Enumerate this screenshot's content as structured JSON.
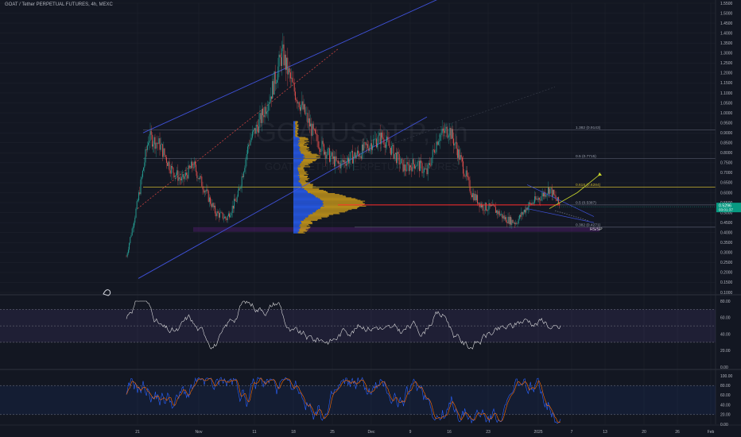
{
  "header": {
    "title": "GOAT / Tether PERPETUAL FUTURES, 4h, MEXC"
  },
  "watermark": {
    "symbol": "GOATUSDT.P, 4h",
    "name": "GOAT / TETHER PERPETUAL FUTURES"
  },
  "colors": {
    "background": "#131722",
    "grid": "#1e222d",
    "candle_up": "#26a69a",
    "candle_down": "#ef5350",
    "channel": "#3f51d8",
    "channel_mid": "#c8413f",
    "fib_line": "#55596a",
    "fib_gold": "#c9b32f",
    "volume_profile_blue": "#2962ff",
    "volume_profile_orange": "#d6a21a",
    "support_zone": "#7b1fa2",
    "resistance_line": "#ff2b2b",
    "rsi_line": "#e8e8e8",
    "rsi_band": "#7e57c2",
    "stoch_k": "#2962ff",
    "stoch_d": "#ff6d00",
    "price_tag": "#089981",
    "arrow": "#c8d62b"
  },
  "chart_data": [
    {
      "type": "candlestick",
      "panel": "price",
      "y_axis_ticks": [
        "1.5500",
        "1.5000",
        "1.4500",
        "1.4000",
        "1.3500",
        "1.3000",
        "1.2500",
        "1.2000",
        "1.1500",
        "1.1000",
        "1.0500",
        "1.0000",
        "0.9500",
        "0.9000",
        "0.8500",
        "0.8000",
        "0.7500",
        "0.7000",
        "0.6500",
        "0.6000",
        "0.5500",
        "0.5000",
        "0.4500",
        "0.4000",
        "0.3500",
        "0.3000",
        "0.2500",
        "0.2000",
        "0.1500",
        "0.1000"
      ],
      "ylim": [
        0.1,
        1.55
      ],
      "x_axis_ticks": [
        "21",
        "Nov",
        "11",
        "18",
        "25",
        "Dec",
        "9",
        "16",
        "23",
        "2025",
        "7",
        "13",
        "20",
        "26",
        "Feb",
        "10"
      ],
      "price_path": {
        "x": [
          "Oct 19",
          "Oct 21",
          "Oct 23",
          "Oct 25",
          "Oct 27",
          "Oct 29",
          "Oct 31",
          "Nov 2",
          "Nov 4",
          "Nov 6",
          "Nov 8",
          "Nov 10",
          "Nov 12",
          "Nov 14",
          "Nov 16",
          "Nov 18",
          "Nov 20",
          "Nov 22",
          "Nov 24",
          "Nov 26",
          "Nov 28",
          "Nov 30",
          "Dec 2",
          "Dec 4",
          "Dec 6",
          "Dec 8",
          "Dec 10",
          "Dec 12",
          "Dec 14",
          "Dec 16",
          "Dec 18",
          "Dec 20",
          "Dec 22",
          "Dec 24",
          "Dec 26",
          "Dec 28",
          "Dec 30",
          "Jan 1",
          "Jan 3",
          "Jan 5"
        ],
        "close": [
          0.28,
          0.55,
          0.88,
          0.84,
          0.72,
          0.66,
          0.74,
          0.62,
          0.5,
          0.47,
          0.58,
          0.85,
          0.96,
          1.1,
          1.3,
          1.12,
          1.0,
          0.87,
          0.8,
          0.74,
          0.77,
          0.8,
          0.85,
          0.88,
          0.8,
          0.72,
          0.75,
          0.7,
          0.88,
          0.92,
          0.77,
          0.6,
          0.53,
          0.52,
          0.47,
          0.45,
          0.53,
          0.57,
          0.62,
          0.53
        ]
      },
      "last_price": "0.5296",
      "last_price_countdown": "03:01:37",
      "fib_levels": [
        {
          "label": "1.382 (0.9143)",
          "value": 0.9143
        },
        {
          "label": "0.5 (0.7715)",
          "value": 0.7715
        },
        {
          "label": "0.618 (0.6284)",
          "value": 0.6284
        },
        {
          "label": "0.5 (0.5387)",
          "value": 0.5387
        },
        {
          "label": "0.382 (0.4271)",
          "value": 0.4271
        }
      ],
      "zones": [
        {
          "label": "RS/SP",
          "top": 0.4271,
          "bottom": 0.404
        }
      ],
      "resistance": 0.5387
    },
    {
      "type": "line",
      "panel": "rsi",
      "y_axis_ticks": [
        "80.00",
        "60.00",
        "40.00",
        "20.00",
        "0.00"
      ],
      "ylim": [
        0,
        80
      ],
      "bands": [
        70,
        50,
        30
      ]
    },
    {
      "type": "line",
      "panel": "stochastic",
      "y_axis_ticks": [
        "100.00",
        "80.00",
        "60.00",
        "40.00",
        "20.00",
        "0.00"
      ],
      "ylim": [
        0,
        100
      ],
      "bands": [
        80,
        20
      ]
    }
  ]
}
